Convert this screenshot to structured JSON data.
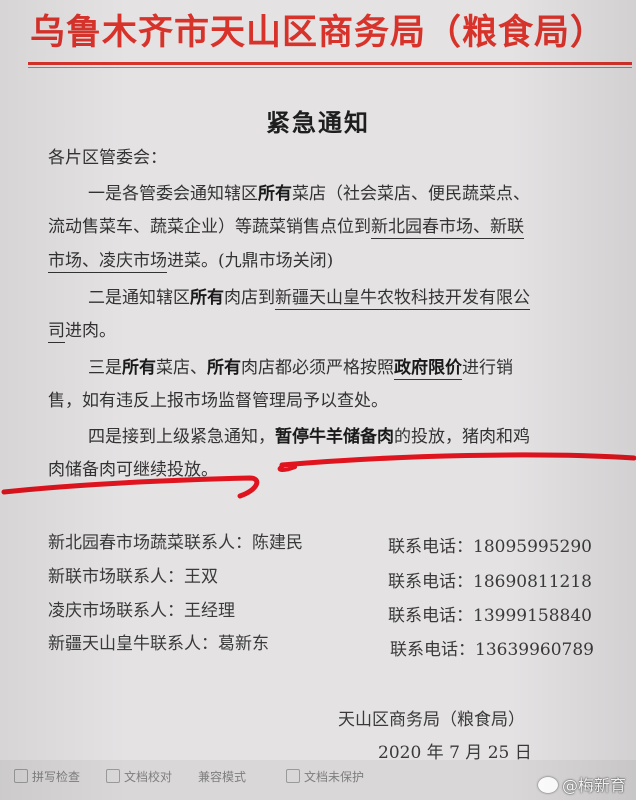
{
  "header": {
    "title": "乌鲁木齐市天山区商务局（粮食局）"
  },
  "document": {
    "title": "紧急通知",
    "salutation": "各片区管委会：",
    "p1": {
      "lead": "一是各管委会通知辖区",
      "bold": "所有",
      "l1_rest": "菜店（社会菜店、便民蔬菜点、",
      "l2_a": "流动售菜车、蔬菜企业）等蔬菜销售点位到",
      "l2_u": "新北园春市场、新联",
      "l3_u": "市场、凌庆市场",
      "l3_b": "进菜。(九鼎市场关闭)"
    },
    "p2": {
      "lead": "二是通知辖区",
      "bold": "所有",
      "mid": "肉店到",
      "l1_u": "新疆天山皇牛农牧科技开发有限公",
      "l2_u": "司",
      "l2_b": "进肉。"
    },
    "p3": {
      "lead": "三是",
      "b1": "所有",
      "m1": "菜店、",
      "b2": "所有",
      "m2": "肉店都必须严格按照",
      "b3": "政府限价",
      "m3": "进行销",
      "l2": "售，如有违反上报市场监督管理局予以查处。"
    },
    "p4": {
      "lead": "四是接到上级紧急通知，",
      "bold": "暂停牛羊储备肉",
      "rest": "的投放，猪肉和鸡",
      "l2": "肉储备肉可继续投放。"
    }
  },
  "contacts": [
    {
      "label": "新北园春市场蔬菜联系人：陈建民",
      "phone": "联系电话：18095995290"
    },
    {
      "label": "新联市场联系人：王双",
      "phone": "联系电话：18690811218"
    },
    {
      "label": "凌庆市场联系人：王经理",
      "phone": "联系电话：13999158840"
    },
    {
      "label": "新疆天山皇牛联系人：葛新东",
      "phone": "联系电话：13639960789"
    }
  ],
  "signature": {
    "org": "天山区商务局（粮食局）",
    "date": "2020 年 7 月 25 日"
  },
  "status_bar": {
    "items": [
      "拼写检查",
      "文档校对",
      "兼容模式",
      "文档未保护"
    ]
  },
  "watermark": {
    "text": "@梅新育"
  },
  "colors": {
    "header_red": "#d8332b",
    "marker_red": "#e0141e",
    "paper": "#e4e2e3"
  }
}
